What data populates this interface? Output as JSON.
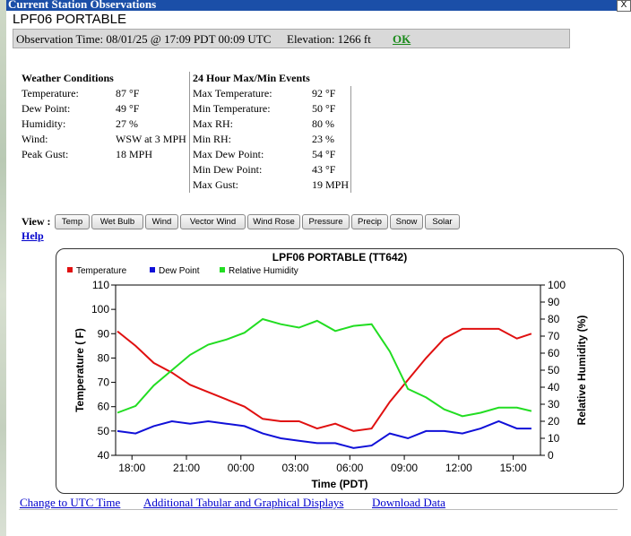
{
  "window": {
    "title": "Current Station Observations",
    "close_label": "X"
  },
  "station": {
    "name": "LPF06 PORTABLE",
    "observation_time": "Observation Time: 08/01/25 @ 17:09 PDT  00:09 UTC",
    "elevation": "Elevation: 1266 ft",
    "ok_label": "OK"
  },
  "conditions": {
    "heading": "Weather Conditions",
    "rows": [
      {
        "label": "Temperature:",
        "value": "87 °F"
      },
      {
        "label": "Dew Point:",
        "value": "49 °F"
      },
      {
        "label": "Humidity:",
        "value": "27 %"
      },
      {
        "label": "Wind:",
        "value": "WSW at 3 MPH"
      },
      {
        "label": "Peak Gust:",
        "value": "18 MPH"
      }
    ]
  },
  "events": {
    "heading": "24 Hour Max/Min Events",
    "rows": [
      {
        "label": "Max Temperature:",
        "value": "92 °F"
      },
      {
        "label": "Min Temperature:",
        "value": "50 °F"
      },
      {
        "label": "Max RH:",
        "value": "80 %"
      },
      {
        "label": "Min RH:",
        "value": "23 %"
      },
      {
        "label": "Max Dew Point:",
        "value": "54 °F"
      },
      {
        "label": "Min Dew Point:",
        "value": "43 °F"
      },
      {
        "label": "Max Gust:",
        "value": "19 MPH"
      }
    ]
  },
  "view": {
    "label": "View :",
    "buttons": [
      "Temp",
      "Wet Bulb",
      "Wind",
      "Vector Wind",
      "Wind Rose",
      "Pressure",
      "Precip",
      "Snow",
      "Solar"
    ]
  },
  "help_label": "Help",
  "footer_links": [
    "Change to UTC Time",
    "Additional Tabular and Graphical Displays",
    "Download Data"
  ],
  "colors": {
    "titlebar": "#1b4fa8",
    "temperature": "#e01010",
    "dew_point": "#1010d8",
    "relative_humidity": "#22dd22",
    "link": "#0000cc",
    "ok": "#1a8a1a"
  },
  "chart_data": {
    "type": "line",
    "title": "LPF06 PORTABLE (TT642)",
    "xlabel": "Time (PDT)",
    "ylabel": "Temperature ( F)",
    "y2label": "Relative Humidity (%)",
    "x_tick_labels": [
      "18:00",
      "21:00",
      "00:00",
      "03:00",
      "06:00",
      "09:00",
      "12:00",
      "15:00"
    ],
    "x_tick_hours": [
      18,
      21,
      24,
      27,
      30,
      33,
      36,
      39
    ],
    "xlim": [
      17.1,
      40.5
    ],
    "ylim": [
      40,
      110
    ],
    "y_ticks": [
      40,
      50,
      60,
      70,
      80,
      90,
      100,
      110
    ],
    "y2lim": [
      0,
      100
    ],
    "y2_ticks": [
      0,
      10,
      20,
      30,
      40,
      50,
      60,
      70,
      80,
      90,
      100
    ],
    "legend_position": "top-left",
    "grid": false,
    "series": [
      {
        "name": "Temperature",
        "axis": "left",
        "color": "#e01010",
        "x": [
          17.2,
          18.2,
          19.2,
          20.2,
          21.2,
          22.2,
          23.2,
          24.2,
          25.2,
          26.2,
          27.2,
          28.2,
          29.2,
          30.2,
          31.2,
          32.2,
          33.2,
          34.2,
          35.2,
          36.2,
          37.2,
          38.2,
          39.2,
          40.0
        ],
        "values": [
          91,
          85,
          78,
          74,
          69,
          66,
          63,
          60,
          55,
          54,
          54,
          51,
          53,
          50,
          51,
          62,
          71,
          80,
          88,
          92,
          92,
          92,
          88,
          90
        ]
      },
      {
        "name": "Dew Point",
        "axis": "left",
        "color": "#1010d8",
        "x": [
          17.2,
          18.2,
          19.2,
          20.2,
          21.2,
          22.2,
          23.2,
          24.2,
          25.2,
          26.2,
          27.2,
          28.2,
          29.2,
          30.2,
          31.2,
          32.2,
          33.2,
          34.2,
          35.2,
          36.2,
          37.2,
          38.2,
          39.2,
          40.0
        ],
        "values": [
          50,
          49,
          52,
          54,
          53,
          54,
          53,
          52,
          49,
          47,
          46,
          45,
          45,
          43,
          44,
          49,
          47,
          50,
          50,
          49,
          51,
          54,
          51,
          51
        ]
      },
      {
        "name": "Relative Humidity",
        "axis": "right",
        "color": "#22dd22",
        "x": [
          17.2,
          18.2,
          19.2,
          20.2,
          21.2,
          22.2,
          23.2,
          24.2,
          25.2,
          26.2,
          27.2,
          28.2,
          29.2,
          30.2,
          31.2,
          32.2,
          33.2,
          34.2,
          35.2,
          36.2,
          37.2,
          38.2,
          39.2,
          40.0
        ],
        "values": [
          25,
          29,
          41,
          50,
          59,
          65,
          68,
          72,
          80,
          77,
          75,
          79,
          73,
          76,
          77,
          61,
          39,
          34,
          27,
          23,
          25,
          28,
          28,
          26
        ]
      }
    ]
  }
}
